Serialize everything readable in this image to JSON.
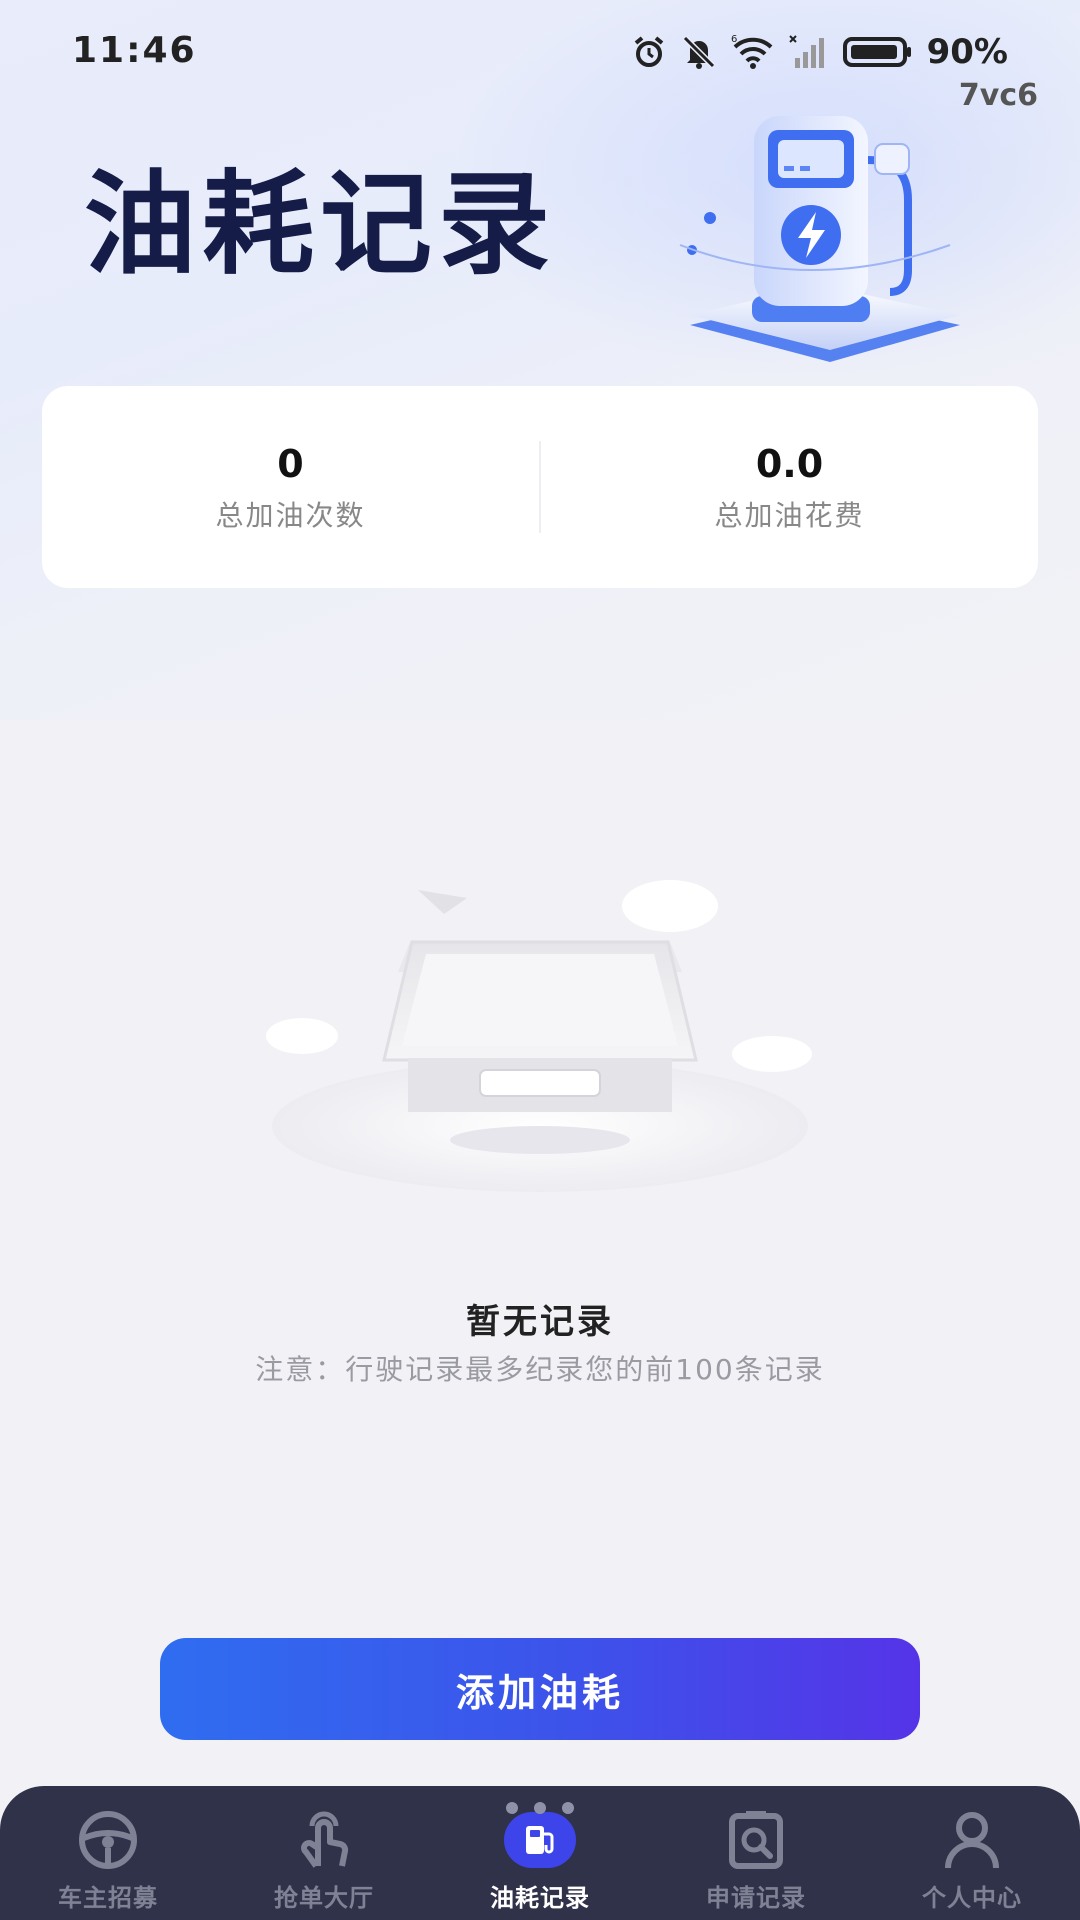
{
  "status_bar": {
    "time": "11:46",
    "battery": "90%",
    "extra": "7vc6",
    "icons": [
      "alarm-icon",
      "mute-icon",
      "wifi-icon",
      "signal-icon",
      "battery-icon"
    ]
  },
  "header": {
    "title": "油耗记录",
    "illustration": "fuel-pump-illustration"
  },
  "stats": [
    {
      "value": "0",
      "label": "总加油次数"
    },
    {
      "value": "0.0",
      "label": "总加油花费"
    }
  ],
  "empty_state": {
    "title": "暂无记录",
    "note": "注意：行驶记录最多纪录您的前100条记录",
    "illustration": "empty-box-illustration"
  },
  "add_button": {
    "label": "添加油耗"
  },
  "colors": {
    "title": "#141c47",
    "accent_start": "#2f6df0",
    "accent_end": "#5534e8",
    "nav_bg": "#30324a",
    "nav_active": "#3d45ea"
  },
  "nav": {
    "active_index": 2,
    "items": [
      {
        "label": "车主招募",
        "icon": "steering-wheel-icon"
      },
      {
        "label": "抢单大厅",
        "icon": "hand-tap-icon"
      },
      {
        "label": "油耗记录",
        "icon": "fuel-pump-icon"
      },
      {
        "label": "申请记录",
        "icon": "document-search-icon"
      },
      {
        "label": "个人中心",
        "icon": "user-icon"
      }
    ]
  }
}
